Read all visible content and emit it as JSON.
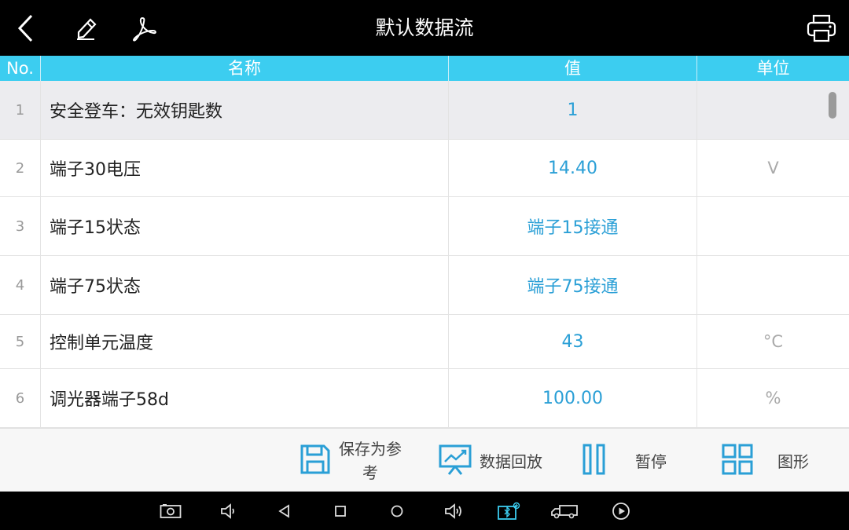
{
  "header": {
    "title": "默认数据流",
    "icons": [
      "back-icon",
      "pencil-icon",
      "pdf-icon",
      "print-icon"
    ]
  },
  "table": {
    "columns": {
      "no": "No.",
      "name": "名称",
      "value": "值",
      "unit": "单位"
    },
    "rows": [
      {
        "no": "1",
        "name": "安全登车：无效钥匙数",
        "value": "1",
        "unit": ""
      },
      {
        "no": "2",
        "name": "端子30电压",
        "value": "14.40",
        "unit": "V"
      },
      {
        "no": "3",
        "name": "端子15状态",
        "value": "端子15接通",
        "unit": ""
      },
      {
        "no": "4",
        "name": "端子75状态",
        "value": "端子75接通",
        "unit": ""
      },
      {
        "no": "5",
        "name": "控制单元温度",
        "value": "43",
        "unit": "°C"
      },
      {
        "no": "6",
        "name": "调光器端子58d",
        "value": "100.00",
        "unit": "%"
      }
    ]
  },
  "toolbar": {
    "save_line1": "保存为参",
    "save_line2": "考",
    "playback_label": "数据回放",
    "pause_label": "暂停",
    "graph_label": "图形"
  },
  "colors": {
    "header_bar": "#000000",
    "table_header": "#3ccdf0",
    "value_text": "#2a9fd6",
    "toolbar_icon": "#2a9fd6"
  },
  "navbar": {
    "icons": [
      "screenshot-icon",
      "volume-down-icon",
      "nav-back-icon",
      "nav-recents-icon",
      "nav-home-icon",
      "volume-up-icon",
      "vci-bluetooth-icon",
      "truck-icon",
      "play-circle-icon"
    ]
  }
}
